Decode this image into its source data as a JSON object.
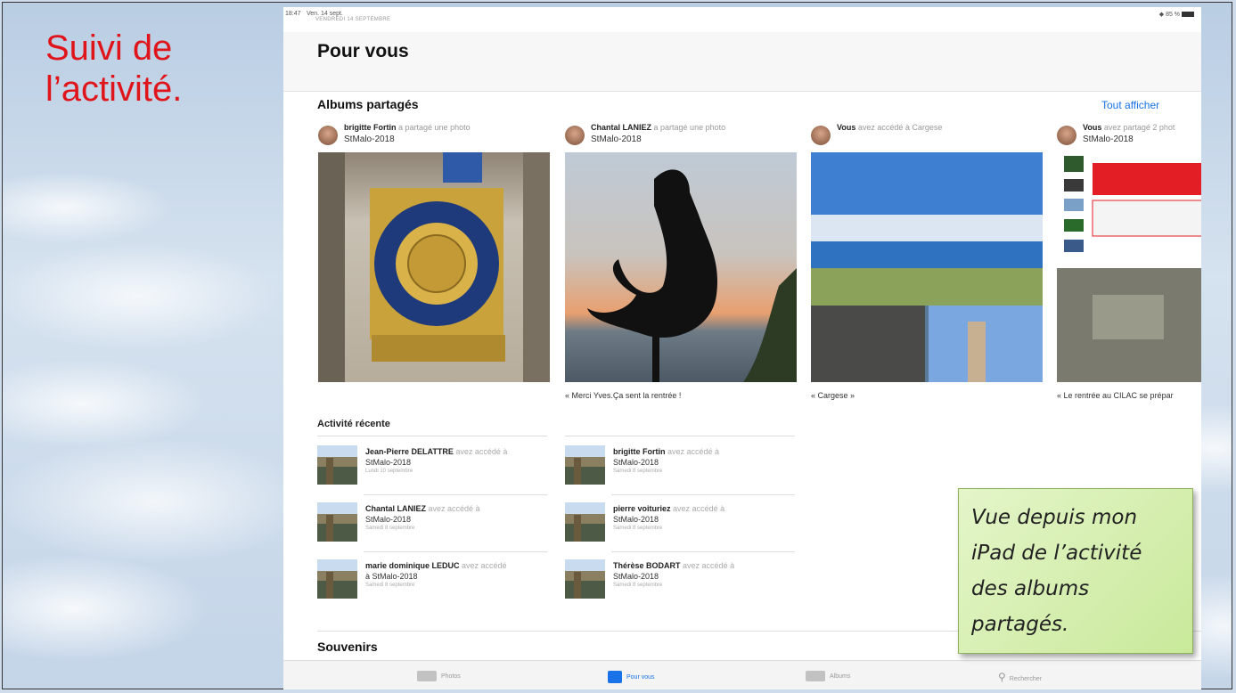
{
  "slide": {
    "title_line1": "Suivi de",
    "title_line2": "l’activité."
  },
  "status_bar": {
    "time": "18:47",
    "date_short": "Ven. 14 sept.",
    "date_long": "VENDREDI 14 SEPTEMBRE",
    "battery": "85 %"
  },
  "page_title": "Pour vous",
  "shared_albums": {
    "title": "Albums partagés",
    "show_all": "Tout afficher",
    "items": [
      {
        "user": "brigitte Fortin",
        "action": "a partagé une photo",
        "album": "StMalo-2018",
        "caption": ""
      },
      {
        "user": "Chantal LANIEZ",
        "action": "a partagé une photo",
        "album": "StMalo-2018",
        "caption": "« Merci Yves.Ça sent la rentrée !"
      },
      {
        "user": "Vous",
        "action": "avez accédé à Cargese",
        "album": "",
        "caption": "« Cargese »"
      },
      {
        "user": "Vous",
        "action": "avez partagé 2 phot",
        "album": "StMalo-2018",
        "caption": "« Le rentrée au CILAC se prépar"
      }
    ]
  },
  "recent_activity": {
    "title": "Activité récente",
    "items": [
      {
        "user": "Jean-Pierre DELATTRE",
        "action": "avez accédé à",
        "album": "StMalo-2018",
        "date": "Lundi 10 septembre"
      },
      {
        "user": "brigitte Fortin",
        "action": "avez accédé à",
        "album": "StMalo-2018",
        "date": "Samedi 8 septembre"
      },
      {
        "user": "Chantal LANIEZ",
        "action": "avez accédé à",
        "album": "StMalo-2018",
        "date": "Samedi 8 septembre"
      },
      {
        "user": "pierre voituriez",
        "action": "avez accédé à",
        "album": "StMalo-2018",
        "date": "Samedi 8 septembre"
      },
      {
        "user": "marie dominique LEDUC",
        "action": "avez accédé",
        "album": "à StMalo-2018",
        "date": "Samedi 8 septembre"
      },
      {
        "user": "Thérèse BODART",
        "action": "avez accédé à",
        "album": "StMalo-2018",
        "date": "Samedi 8 septembre"
      }
    ]
  },
  "souvenirs": "Souvenirs",
  "tabs": [
    {
      "label": "Photos",
      "icon": "photos-icon"
    },
    {
      "label": "Pour vous",
      "icon": "for-you-icon"
    },
    {
      "label": "Albums",
      "icon": "albums-icon"
    },
    {
      "label": "Rechercher",
      "icon": "search-icon"
    }
  ],
  "note": {
    "line1": "Vue depuis mon",
    "line2": "iPad de l’activité",
    "line3": "des albums",
    "line4": "partagés."
  },
  "colors": {
    "slide_title": "#e0141b",
    "accent": "#1a72e8",
    "note_bg": "#d6efb0"
  }
}
